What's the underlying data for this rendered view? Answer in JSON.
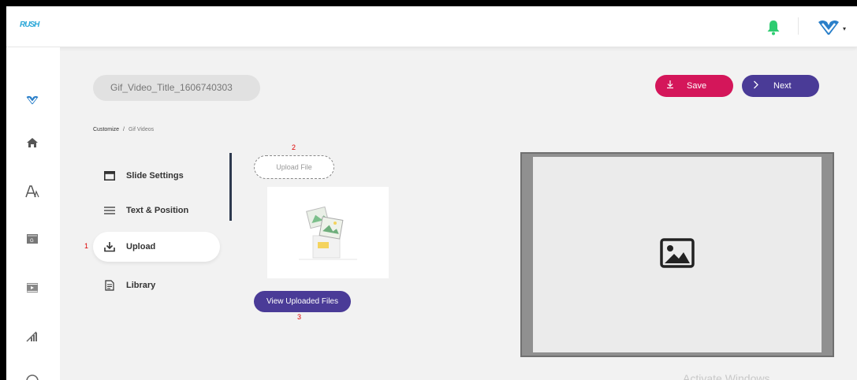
{
  "app": {
    "logo_text": "RUSH"
  },
  "header": {
    "notification_icon": "bell-icon",
    "account_icon": "brand-logo-icon",
    "caret": "▾"
  },
  "sidebar": {
    "items": [
      {
        "icon": "brand-logo-icon"
      },
      {
        "icon": "home-icon"
      },
      {
        "icon": "font-icon"
      },
      {
        "icon": "gif-icon"
      },
      {
        "icon": "video-icon"
      },
      {
        "icon": "analytics-icon"
      },
      {
        "icon": "help-icon"
      }
    ]
  },
  "toolbar": {
    "title_value": "Gif_Video_Title_1606740303",
    "save_label": "Save",
    "next_label": "Next",
    "save_color": "#d4165a",
    "next_color": "#4a3b97"
  },
  "breadcrumb": {
    "parent": "Customize",
    "separator": "/",
    "current": "Gif Videos"
  },
  "menu": {
    "items": [
      {
        "label": "Slide Settings",
        "icon": "slide-icon"
      },
      {
        "label": "Text & Position",
        "icon": "lines-icon"
      },
      {
        "label": "Upload",
        "icon": "download-icon",
        "active": true
      },
      {
        "label": "Library",
        "icon": "document-icon"
      }
    ]
  },
  "annotations": {
    "n1": "1",
    "n2": "2",
    "n3": "3"
  },
  "upload": {
    "upload_file_label": "Upload File",
    "view_uploaded_label": "View Uploaded Files"
  },
  "preview": {
    "placeholder_icon": "image-icon"
  },
  "watermark": "Activate Windows"
}
